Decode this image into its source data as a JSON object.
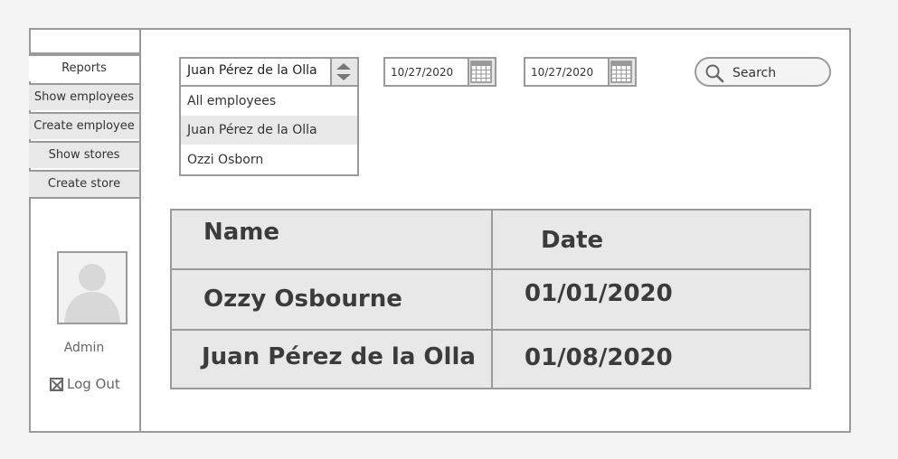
{
  "sidebar": {
    "nav": [
      {
        "label": "Reports",
        "active": true
      },
      {
        "label": "Show employees",
        "active": false
      },
      {
        "label": "Create employee",
        "active": false
      },
      {
        "label": "Show stores",
        "active": false
      },
      {
        "label": "Create store",
        "active": false
      }
    ],
    "user": {
      "name": "Admin"
    },
    "logout_label": "Log Out"
  },
  "filters": {
    "employee_select": {
      "value": "Juan Pérez de la Olla",
      "options": [
        "All employees",
        "Juan Pérez de la Olla",
        "Ozzi Osborn"
      ]
    },
    "date_from": "10/27/2020",
    "date_to": "10/27/2020",
    "search": {
      "placeholder": "Search"
    }
  },
  "table": {
    "headers": [
      "Name",
      "Date"
    ],
    "rows": [
      {
        "name": "Ozzy Osbourne",
        "date": "01/01/2020"
      },
      {
        "name": "Juan Pérez de la Olla",
        "date": "01/08/2020"
      }
    ]
  },
  "colors": {
    "border": "#9a9a9a",
    "fill": "#e8e8e8",
    "text": "#333333"
  }
}
